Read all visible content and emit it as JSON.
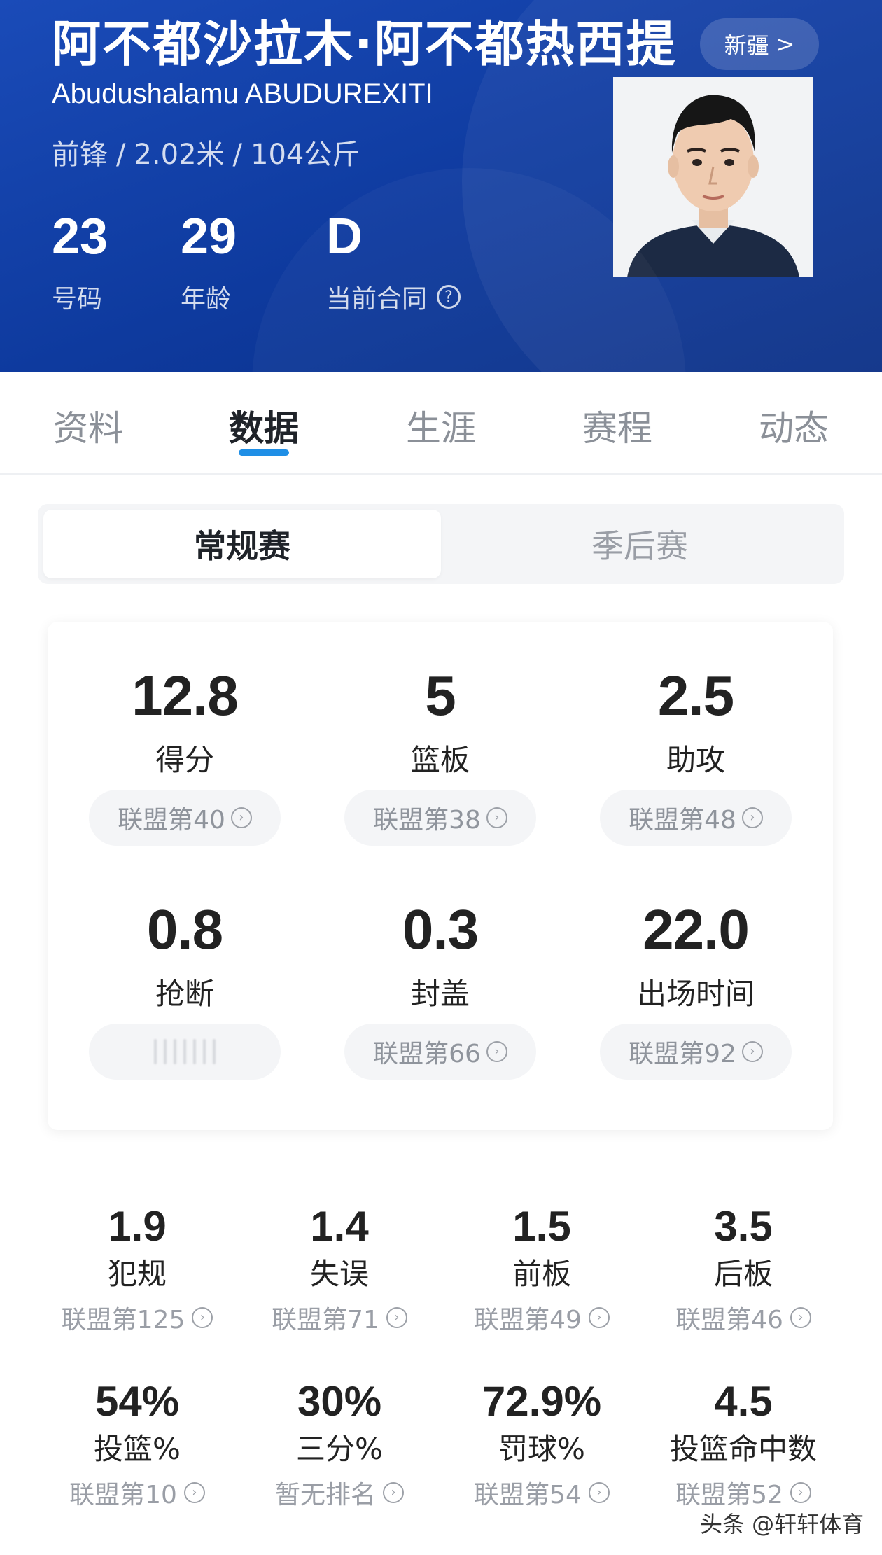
{
  "player": {
    "name_cn": "阿不都沙拉木·阿不都热西提",
    "name_en": "Abudushalamu ABUDUREXITI",
    "position": "前锋",
    "height": "2.02米",
    "weight": "104公斤",
    "team": "新疆",
    "team_arrow": ">",
    "header_stats": [
      {
        "value": "23",
        "label": "号码"
      },
      {
        "value": "29",
        "label": "年龄"
      },
      {
        "value": "D",
        "label": "当前合同"
      }
    ],
    "help_icon_glyph": "?"
  },
  "tabs": [
    "资料",
    "数据",
    "生涯",
    "赛程",
    "动态"
  ],
  "active_tab": "数据",
  "season_switch": {
    "selected": "常规赛",
    "other": "季后赛"
  },
  "main_stats": [
    {
      "value": "12.8",
      "label": "得分",
      "rank": "联盟第40"
    },
    {
      "value": "5",
      "label": "篮板",
      "rank": "联盟第38"
    },
    {
      "value": "2.5",
      "label": "助攻",
      "rank": "联盟第48"
    },
    {
      "value": "0.8",
      "label": "抢断",
      "rank": ""
    },
    {
      "value": "0.3",
      "label": "封盖",
      "rank": "联盟第66"
    },
    {
      "value": "22.0",
      "label": "出场时间",
      "rank": "联盟第92"
    }
  ],
  "secondary_stats": [
    {
      "value": "1.9",
      "label": "犯规",
      "rank": "联盟第125"
    },
    {
      "value": "1.4",
      "label": "失误",
      "rank": "联盟第71"
    },
    {
      "value": "1.5",
      "label": "前板",
      "rank": "联盟第49"
    },
    {
      "value": "3.5",
      "label": "后板",
      "rank": "联盟第46"
    },
    {
      "value": "54%",
      "label": "投篮%",
      "rank": "联盟第10"
    },
    {
      "value": "30%",
      "label": "三分%",
      "rank": "暂无排名"
    },
    {
      "value": "72.9%",
      "label": "罚球%",
      "rank": "联盟第54"
    },
    {
      "value": "4.5",
      "label": "投篮命中数",
      "rank": "联盟第52"
    }
  ],
  "watermark": "头条 @轩轩体育",
  "colors": {
    "header_blue": "#0e3a9e",
    "tab_accent": "#1f8fe6"
  }
}
